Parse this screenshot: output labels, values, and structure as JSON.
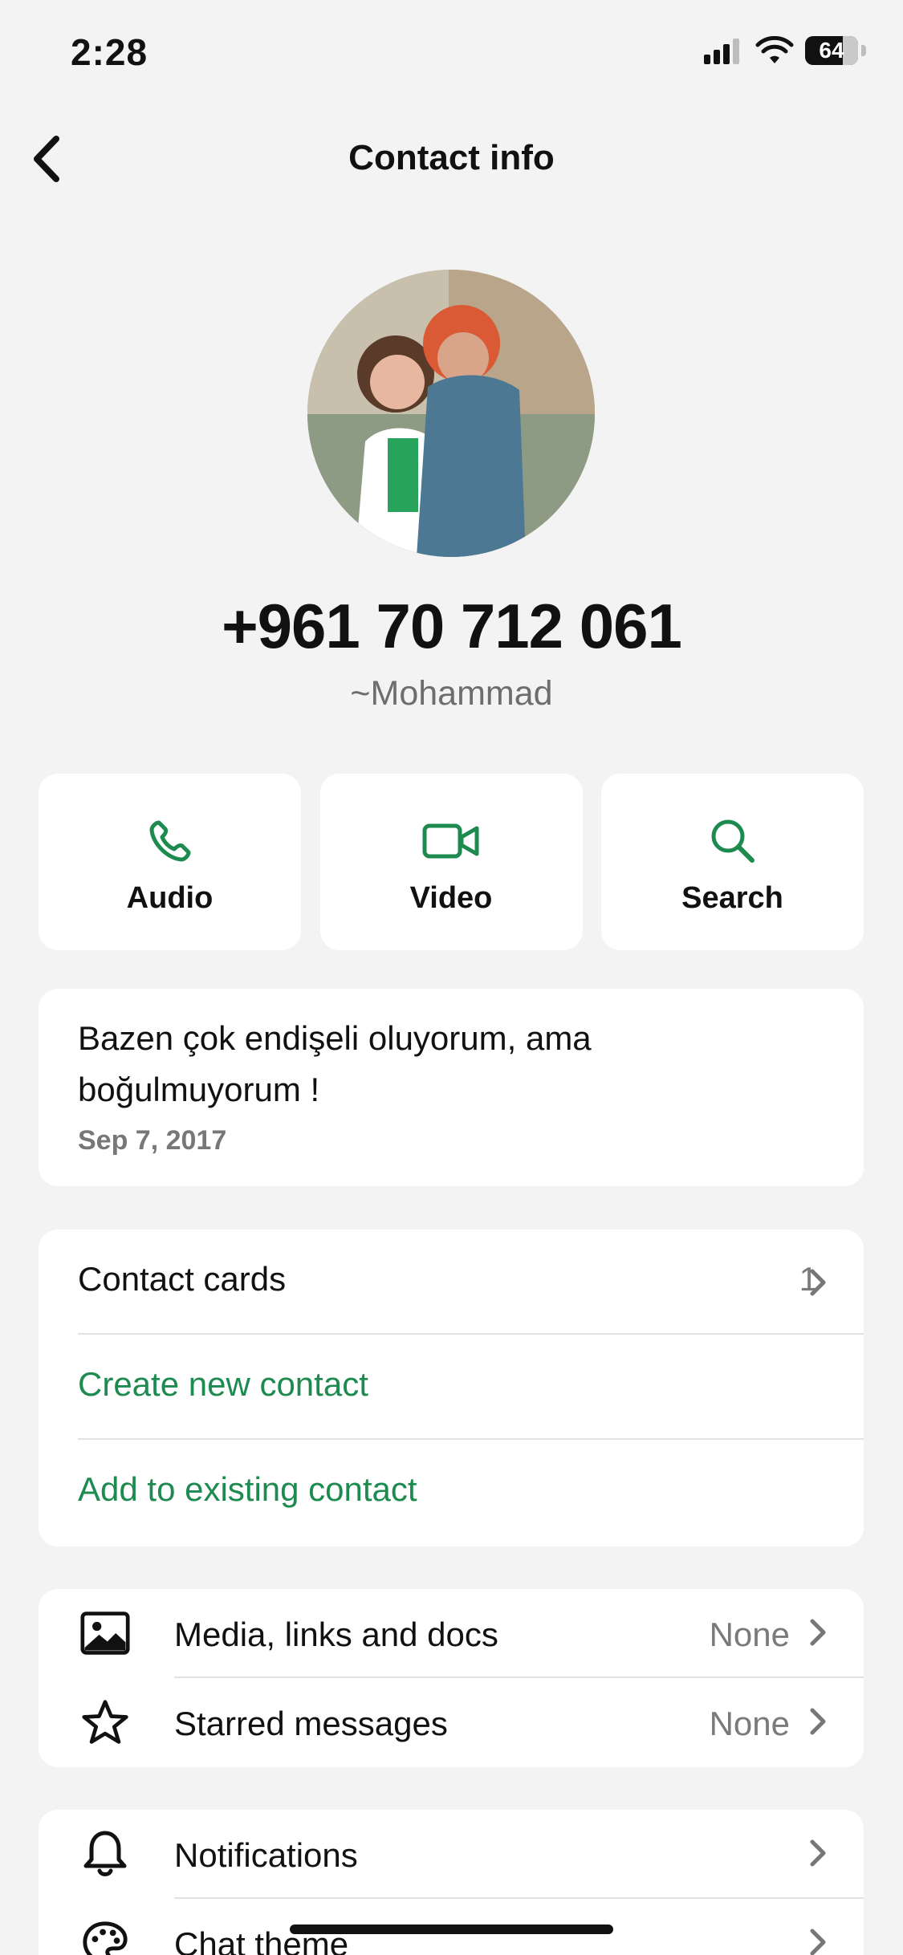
{
  "status_bar": {
    "time": "2:28",
    "battery": "64"
  },
  "nav": {
    "title": "Contact info"
  },
  "profile": {
    "phone": "+961 70 712 061",
    "name": "~Mohammad",
    "avatar_icon": "profile-photo"
  },
  "actions": [
    {
      "label": "Audio",
      "icon": "phone-icon"
    },
    {
      "label": "Video",
      "icon": "video-icon"
    },
    {
      "label": "Search",
      "icon": "search-icon"
    }
  ],
  "about": {
    "text": "Bazen çok endişeli oluyorum, ama boğulmuyorum !",
    "date": "Sep 7, 2017"
  },
  "contact_cards": {
    "label": "Contact cards",
    "count": "1",
    "create_label": "Create new contact",
    "add_label": "Add to existing contact"
  },
  "media": [
    {
      "label": "Media, links and docs",
      "value": "None",
      "icon": "image-icon"
    },
    {
      "label": "Starred messages",
      "value": "None",
      "icon": "star-icon"
    }
  ],
  "settings": [
    {
      "label": "Notifications",
      "icon": "bell-icon"
    },
    {
      "label": "Chat theme",
      "icon": "palette-icon"
    }
  ],
  "colors": {
    "accent": "#1d8a4f",
    "background": "#f3f3f3",
    "card": "#ffffff",
    "muted_text": "#777777"
  }
}
